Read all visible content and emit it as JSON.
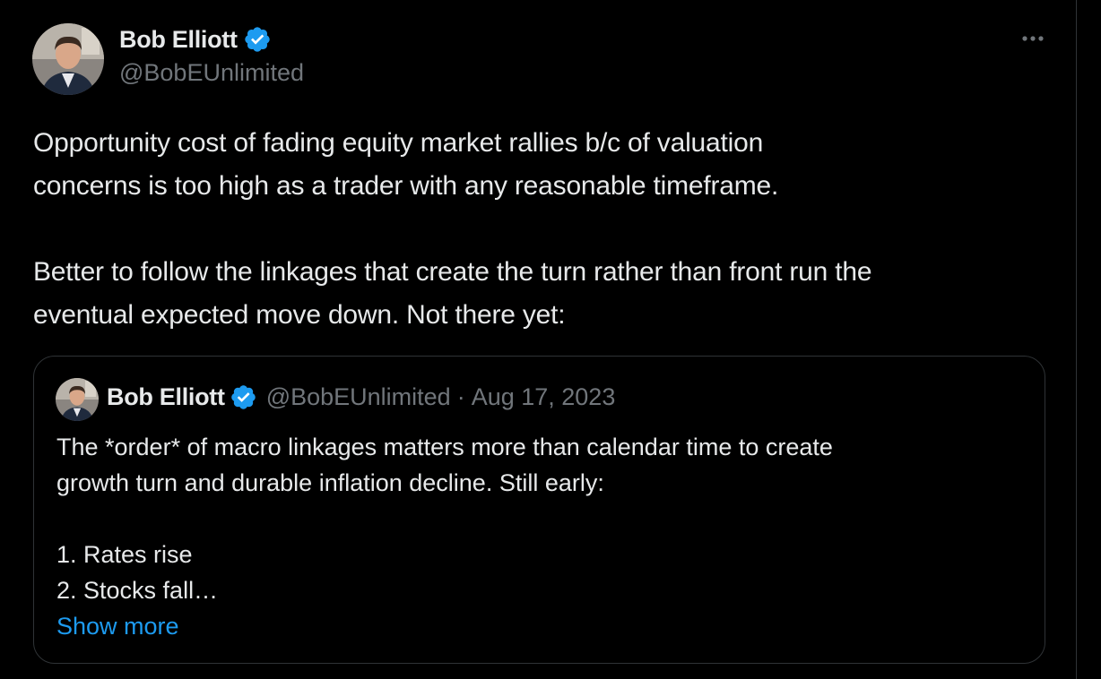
{
  "tweet": {
    "author": {
      "display_name": "Bob Elliott",
      "handle": "@BobEUnlimited",
      "verified_icon": "verified-badge-icon",
      "avatar_icon": "avatar-photo"
    },
    "more_icon": "more-options-icon",
    "paragraphs": [
      "Opportunity cost of fading equity market rallies b/c of valuation\nconcerns is too high as a trader with any reasonable timeframe.",
      "Better to follow the linkages that create the turn rather than front run the\neventual expected move down. Not there yet:"
    ],
    "quote": {
      "author": {
        "display_name": "Bob Elliott",
        "handle": "@BobEUnlimited",
        "verified_icon": "verified-badge-icon"
      },
      "separator": "·",
      "date": "Aug 17, 2023",
      "lines": [
        "The *order* of macro linkages matters more than calendar time to create",
        "growth turn and durable inflation decline. Still early:",
        "",
        "1. Rates rise",
        "2. Stocks fall…"
      ],
      "show_more_label": "Show more"
    }
  },
  "colors": {
    "background": "#000000",
    "text_primary": "#e7e9ea",
    "text_secondary": "#71767b",
    "accent": "#1d9bf0",
    "border": "#2f3336"
  }
}
